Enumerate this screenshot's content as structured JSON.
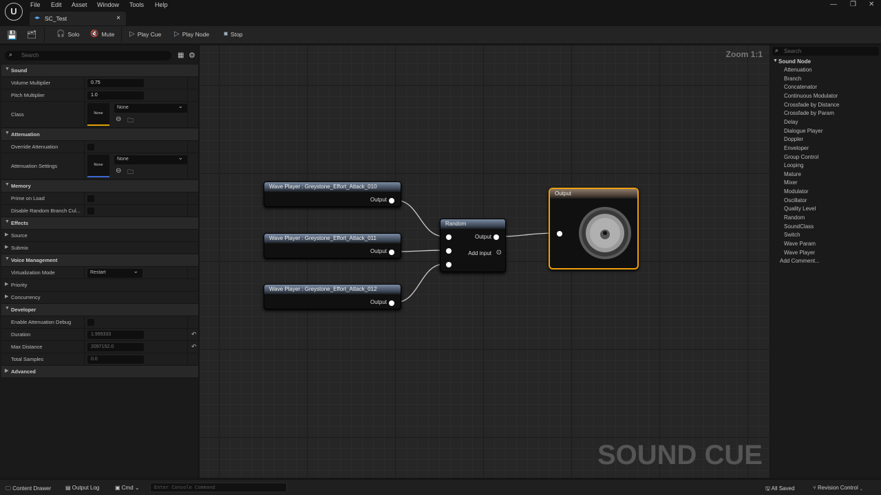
{
  "menu": [
    "File",
    "Edit",
    "Asset",
    "Window",
    "Tools",
    "Help"
  ],
  "tab": {
    "title": "SC_Test",
    "close": "×"
  },
  "window_controls": [
    "—",
    "❐",
    "✕"
  ],
  "toolbar": {
    "solo": "Solo",
    "mute": "Mute",
    "play_cue": "Play Cue",
    "play_node": "Play Node",
    "stop": "Stop"
  },
  "details": {
    "search_placeholder": "Search",
    "sound": "Sound",
    "volume_label": "Volume Multiplier",
    "volume": "0.75",
    "pitch_label": "Pitch Multiplier",
    "pitch": "1.0",
    "class_label": "Class",
    "class_thumb": "None",
    "class_value": "None",
    "attenuation": "Attenuation",
    "override_label": "Override Attenuation",
    "att_settings_label": "Attenuation Settings",
    "att_thumb": "None",
    "att_value": "None",
    "memory": "Memory",
    "prime_label": "Prime on Load",
    "disable_label": "Disable Random Branch Cul...",
    "effects": "Effects",
    "source": "Source",
    "submix": "Submix",
    "voice": "Voice Management",
    "virt_label": "Virtualization Mode",
    "virt_value": "Restart",
    "priority": "Priority",
    "concurrency": "Concurrency",
    "developer": "Developer",
    "enable_debug_label": "Enable Attenuation Debug",
    "duration_label": "Duration",
    "duration": "1.999333",
    "maxdist_label": "Max Distance",
    "maxdist": "2097152.0",
    "samples_label": "Total Samples",
    "samples": "0.0",
    "advanced": "Advanced"
  },
  "graph": {
    "zoom": "Zoom 1:1",
    "watermark": "SOUND CUE",
    "wave_players": [
      "Wave Player : Greystone_Effort_Attack_010",
      "Wave Player : Greystone_Effort_Attack_011",
      "Wave Player : Greystone_Effort_Attack_012"
    ],
    "output_pin": "Output",
    "random_title": "Random",
    "add_input": "Add input",
    "output_title": "Output"
  },
  "palette": {
    "search_placeholder": "Search",
    "category": "Sound Node",
    "items": [
      "Attenuation",
      "Branch",
      "Concatenator",
      "Continuous Modulator",
      "Crossfade by Distance",
      "Crossfade by Param",
      "Delay",
      "Dialogue Player",
      "Doppler",
      "Enveloper",
      "Group Control",
      "Looping",
      "Mature",
      "Mixer",
      "Modulator",
      "Oscillator",
      "Quality Level",
      "Random",
      "SoundClass",
      "Switch",
      "Wave Param",
      "Wave Player"
    ],
    "add_comment": "Add Comment..."
  },
  "status": {
    "content_drawer": "Content Drawer",
    "output_log": "Output Log",
    "cmd": "Cmd",
    "console_placeholder": "Enter Console Command",
    "saved": "All Saved",
    "revision": "Revision Control"
  }
}
